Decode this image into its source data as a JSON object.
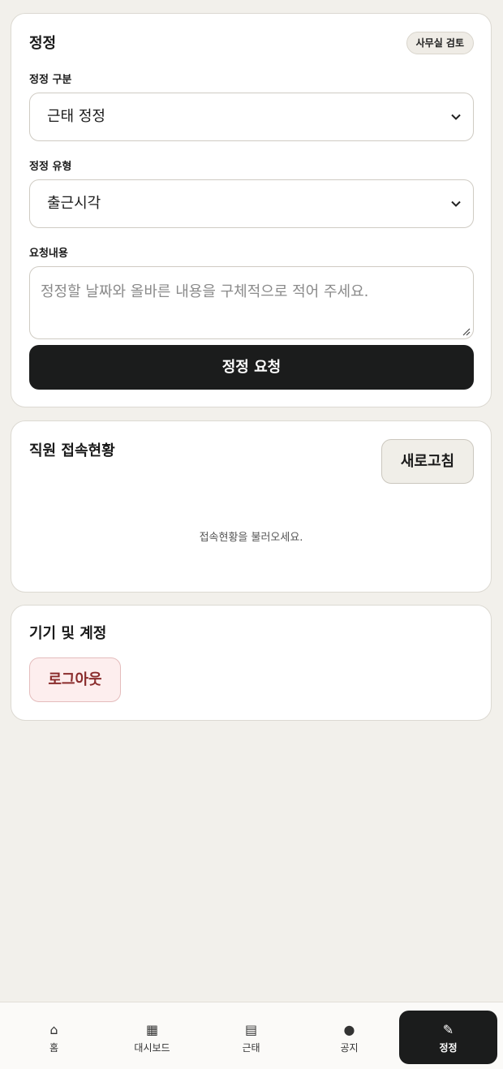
{
  "correction_card": {
    "title": "정정",
    "badge": "사무실 검토",
    "category_label": "정정 구분",
    "category_value": "근태 정정",
    "type_label": "정정 유형",
    "type_value": "출근시각",
    "content_label": "요청내용",
    "content_placeholder": "정정할 날짜와 올바른 내용을 구체적으로 적어 주세요.",
    "submit_label": "정정 요청"
  },
  "status_card": {
    "title": "직원 접속현황",
    "refresh_label": "새로고침",
    "empty_text": "접속현황을 불러오세요."
  },
  "device_card": {
    "title": "기기 및 계정",
    "logout_label": "로그아웃"
  },
  "bottom_nav": {
    "items": [
      {
        "label": "홈",
        "icon": "home-icon",
        "glyph": "⌂"
      },
      {
        "label": "대시보드",
        "icon": "grid-icon",
        "glyph": "▦"
      },
      {
        "label": "근태",
        "icon": "list-icon",
        "glyph": "▤"
      },
      {
        "label": "공지",
        "icon": "dot-icon",
        "glyph": "●"
      },
      {
        "label": "정정",
        "icon": "pencil-icon",
        "glyph": "✎"
      }
    ],
    "active": "정정"
  },
  "colors": {
    "background": "#f2f0eb",
    "primary_button": "#1b1c1c",
    "logout_text": "#8a2c2c",
    "logout_bg": "#fdeeee"
  }
}
